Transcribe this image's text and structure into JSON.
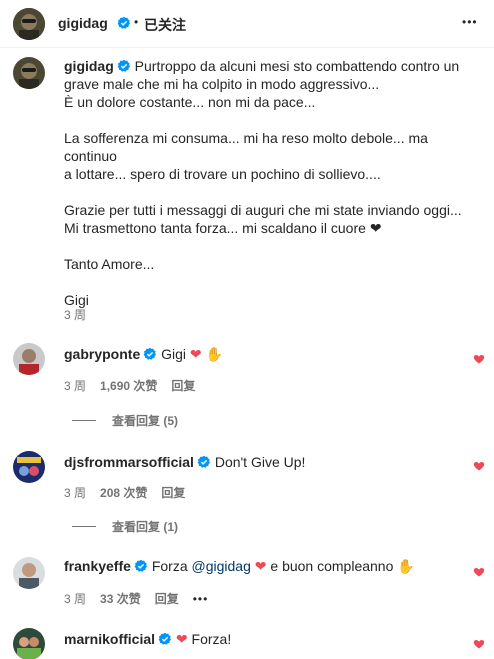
{
  "header": {
    "username": "gigidag",
    "separator": "•",
    "follow_status": "已关注",
    "more": "•••"
  },
  "caption": {
    "username": "gigidag",
    "lines": [
      "Purtroppo da alcuni mesi sto combattendo contro un",
      "grave male che mi ha colpito in modo aggressivo...",
      "È un dolore costante... non mi da pace...",
      "La sofferenza mi consuma... mi ha reso molto debole... ma continuo",
      "a lottare... spero di trovare un pochino di sollievo....",
      "Grazie per tutti i messaggi di auguri che mi state inviando oggi...",
      "Mi trasmettono tanta forza... mi scaldano il cuore",
      "Tanto Amore...",
      "Gigi"
    ],
    "time": "3 周"
  },
  "comments": [
    {
      "username": "gabryponte",
      "text": "Gigi",
      "time": "3 周",
      "likes": "1,690 次赞",
      "reply": "回复",
      "view_replies": "查看回复 (5)"
    },
    {
      "username": "djsfrommarsofficial",
      "text": "Don't Give Up!",
      "time": "3 周",
      "likes": "208 次赞",
      "reply": "回复",
      "view_replies": "查看回复 (1)"
    },
    {
      "username": "frankyeffe",
      "text_prefix": "Forza",
      "mention": "@gigidag",
      "text_suffix": "e buon compleanno",
      "time": "3 周",
      "likes": "33 次赞",
      "reply": "回复",
      "more": "•••"
    },
    {
      "username": "marnikofficial",
      "text": "Forza!"
    }
  ],
  "colors": {
    "verified": "#0095f6",
    "heart": "#ed4956",
    "meta": "#737373",
    "mention": "#00376b"
  }
}
